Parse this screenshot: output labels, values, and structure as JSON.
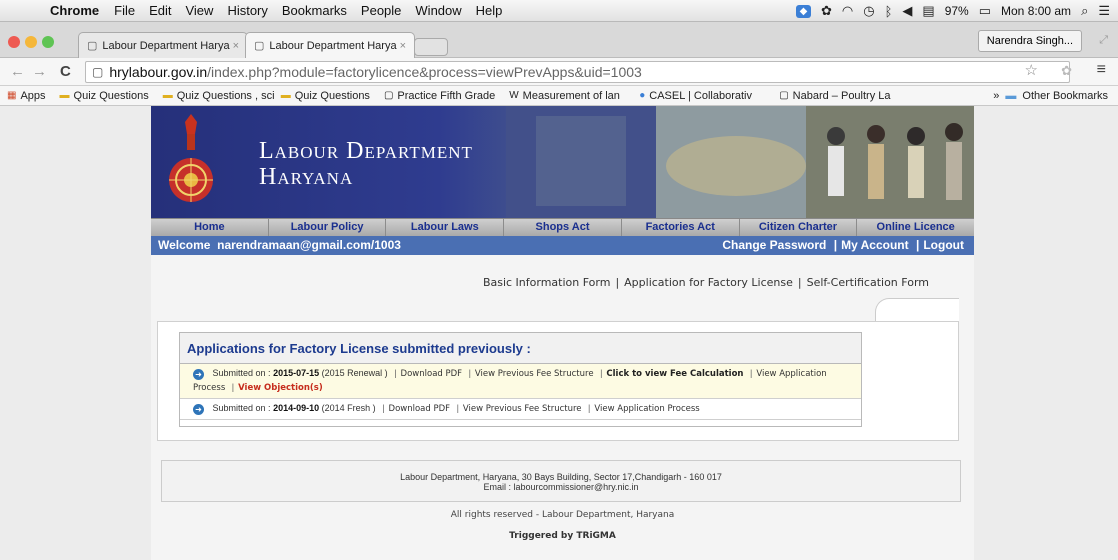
{
  "menubar": {
    "app": "Chrome",
    "items": [
      "File",
      "Edit",
      "View",
      "History",
      "Bookmarks",
      "People",
      "Window",
      "Help"
    ],
    "battery": "97%",
    "clock": "Mon 8:00 am"
  },
  "tabs": [
    {
      "title": "Labour Department Harya"
    },
    {
      "title": "Labour Department Harya"
    }
  ],
  "profile": "Narendra Singh...",
  "address": {
    "host": "hrylabour.gov.in",
    "path": "/index.php?module=factorylicence&process=viewPrevApps&uid=1003"
  },
  "bookmarks": {
    "items": [
      "Apps",
      "Quiz Questions",
      "Quiz Questions , sci",
      "Quiz Questions",
      "Practice Fifth Grade",
      "Measurement of lan",
      "CASEL | Collaborativ",
      "Nabard – Poultry La"
    ],
    "more": "»",
    "other": "Other Bookmarks"
  },
  "site": {
    "title_line1": "Labour Department",
    "title_line2": "Haryana",
    "nav": [
      "Home",
      "Labour Policy",
      "Labour Laws",
      "Shops Act",
      "Factories Act",
      "Citizen Charter",
      "Online Licence"
    ],
    "welcome": "Welcome  narendramaan@gmail.com/1003",
    "account_links": [
      "Change Password",
      "My Account",
      "Logout"
    ],
    "form_links": [
      "Basic Information Form",
      "Application for Factory License",
      "Self-Certification Form"
    ],
    "panel_title": "Applications for Factory License submitted previously :",
    "applications": [
      {
        "prefix": "Submitted on :",
        "date": "2015-07-15",
        "type": "(2015 Renewal )",
        "links": [
          "Download PDF",
          "View Previous Fee Structure"
        ],
        "bold_link": "Click to view Fee Calculation",
        "process_link": "View Application Process",
        "objection": "View Objection(s)"
      },
      {
        "prefix": "Submitted on :",
        "date": "2014-09-10",
        "type": "(2014 Fresh )",
        "links": [
          "Download PDF",
          "View Previous Fee Structure",
          "View Application Process"
        ]
      }
    ],
    "footer_line1": "Labour Department, Haryana, 30 Bays Building, Sector 17,Chandigarh - 160 017",
    "footer_line2": "Email : labourcommissioner@hry.nic.in",
    "rights": "All rights reserved - Labour Department, Haryana",
    "triggered_prefix": "Triggered by ",
    "triggered_brand": "TRiGMA"
  }
}
